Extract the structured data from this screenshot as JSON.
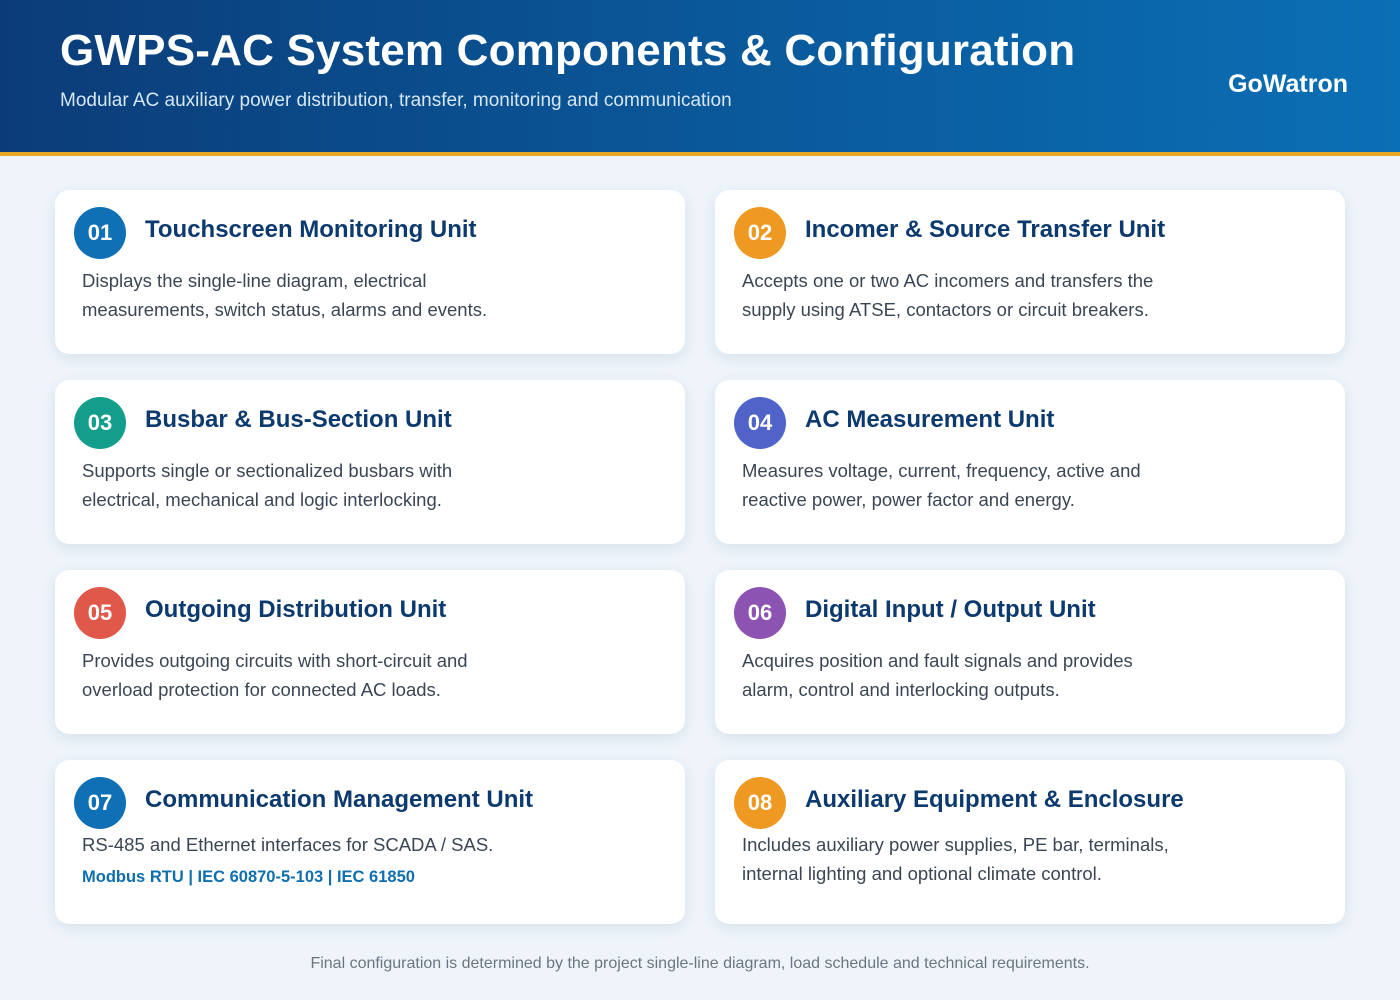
{
  "header": {
    "title": "GWPS-AC System Components & Configuration",
    "subtitle": "Modular AC auxiliary power distribution, transfer, monitoring and communication",
    "brand": "GoWatron"
  },
  "cards": [
    {
      "number": "01",
      "title": "Touchscreen Monitoring Unit",
      "description": "Displays the single-line diagram, electrical measurements, switch status, alarms and events.",
      "color": "#0f70b5"
    },
    {
      "number": "02",
      "title": "Incomer & Source Transfer Unit",
      "description": "Accepts one or two AC incomers and transfers the supply using ATSE, contactors or circuit breakers.",
      "color": "#ee9a22"
    },
    {
      "number": "03",
      "title": "Busbar & Bus-Section Unit",
      "description": "Supports single or sectionalized busbars with electrical, mechanical and logic interlocking.",
      "color": "#129e8a"
    },
    {
      "number": "04",
      "title": "AC Measurement Unit",
      "description": "Measures voltage, current, frequency, active and reactive power, power factor and energy.",
      "color": "#4f63c9"
    },
    {
      "number": "05",
      "title": "Outgoing Distribution Unit",
      "description": "Provides outgoing circuits with short-circuit and overload protection for connected AC loads.",
      "color": "#e0584a"
    },
    {
      "number": "06",
      "title": "Digital Input / Output Unit",
      "description": "Acquires position and fault signals and provides alarm, control and interlocking outputs.",
      "color": "#8c53b3"
    },
    {
      "number": "07",
      "title": "Communication Management Unit",
      "description": "RS-485 and Ethernet interfaces for SCADA / SAS.",
      "protocols": "Modbus RTU | IEC 60870-5-103 | IEC 61850",
      "color": "#0f70b5"
    },
    {
      "number": "08",
      "title": "Auxiliary Equipment & Enclosure",
      "description": "Includes auxiliary power supplies, PE bar, terminals, internal lighting and optional climate control.",
      "color": "#ee9a22"
    }
  ],
  "footer": "Final configuration is determined by the project single-line diagram, load schedule and technical requirements."
}
